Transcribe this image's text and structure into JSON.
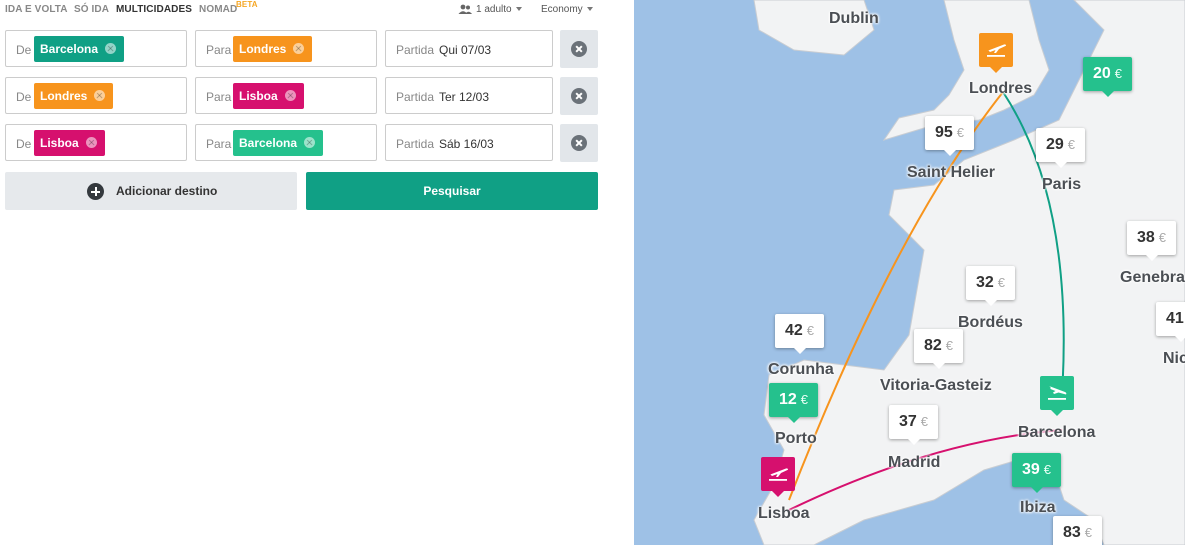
{
  "tabs": [
    {
      "label": "IDA E VOLTA",
      "active": false
    },
    {
      "label": "SÓ IDA",
      "active": false
    },
    {
      "label": "MULTICIDADES",
      "active": true
    },
    {
      "label": "NOMAD",
      "active": false
    }
  ],
  "beta_label": "BETA",
  "passengers": "1 adulto",
  "cabin_class": "Economy",
  "field_labels": {
    "from": "De",
    "to": "Para",
    "departure": "Partida"
  },
  "legs": [
    {
      "from": "Barcelona",
      "from_color": "#10a085",
      "to": "Londres",
      "to_color": "#f7941d",
      "date": "Qui 07/03"
    },
    {
      "from": "Londres",
      "from_color": "#f7941d",
      "to": "Lisboa",
      "to_color": "#d6106e",
      "date": "Ter 12/03"
    },
    {
      "from": "Lisboa",
      "from_color": "#d6106e",
      "to": "Barcelona",
      "to_color": "#25c18d",
      "date": "Sáb 16/03"
    }
  ],
  "add_destination_label": "Adicionar destino",
  "search_label": "Pesquisar",
  "map": {
    "cities": [
      "Dublin",
      "Londres",
      "Saint Helier",
      "Paris",
      "Genebra",
      "Bordéus",
      "Corunha",
      "Vitoria-Gasteiz",
      "Porto",
      "Madrid",
      "Barcelona",
      "Ibiza",
      "Lisboa",
      "Nic"
    ],
    "currency": "€",
    "prices": [
      {
        "value": "20",
        "highlight": true
      },
      {
        "value": "95",
        "highlight": false
      },
      {
        "value": "29",
        "highlight": false
      },
      {
        "value": "38",
        "highlight": false
      },
      {
        "value": "32",
        "highlight": false
      },
      {
        "value": "41",
        "highlight": false
      },
      {
        "value": "42",
        "highlight": false
      },
      {
        "value": "82",
        "highlight": false
      },
      {
        "value": "12",
        "highlight": true
      },
      {
        "value": "37",
        "highlight": false
      },
      {
        "value": "39",
        "highlight": true
      },
      {
        "value": "83",
        "highlight": false
      }
    ],
    "route_colors": {
      "leg1": "#10a085",
      "leg2": "#f7941d",
      "leg3": "#d6106e"
    },
    "land_color": "#f2f3f4",
    "sea_color": "#9ec1e6"
  }
}
